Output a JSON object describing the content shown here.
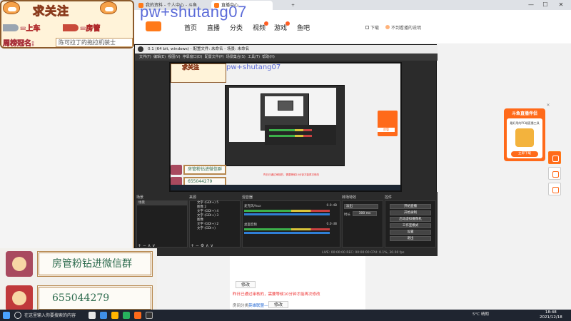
{
  "browser": {
    "tabs": [
      {
        "label": "..."
      },
      {
        "label": "我的资料 - 个人中心 - 斗鱼"
      },
      {
        "label": "直播中心"
      },
      {
        "label": "+"
      }
    ],
    "window_controls": [
      "—",
      "☐",
      "✕"
    ]
  },
  "site": {
    "nav": [
      "首页",
      "直播",
      "分类",
      "视频",
      "游戏",
      "鱼吧"
    ],
    "header_right": [
      "下载",
      "不到看播的说明"
    ]
  },
  "overlay": {
    "title": "求关注",
    "row1_text": "=上车",
    "row2_text": "=房管",
    "fan_label": "周榜冠名:",
    "fan_name": "陈可拉丁的拖拉机装士",
    "stream_id": "pw+shutang07",
    "box1_text": "房管粉钻进微信群",
    "box2_text": "655044279"
  },
  "obs": {
    "title": "0.1 (64 bit, windows) - 配置文件: 未命名 - 场景: 未命名",
    "menu": [
      "文件(F)",
      "编辑(E)",
      "视图(V)",
      "停靠窗口(D)",
      "配置文件(P)",
      "场景集合(S)",
      "工具(T)",
      "帮助(H)"
    ],
    "docks": {
      "scenes": "场景",
      "sources": "来源",
      "mixer": "混音器",
      "transitions": "转场特效",
      "controls": "控件"
    },
    "scene_items": [
      "场景"
    ],
    "source_items": [
      "文字 (GDI+) 5",
      "图像 2",
      "文字 (GDI+) 4",
      "文字 (GDI+) 3",
      "图像",
      "文字 (GDI+) 2",
      "文字 (GDI+)"
    ],
    "mixer_tracks": [
      {
        "name": "桌面音频",
        "db": "0.0 dB"
      },
      {
        "name": "麦克风/Aux",
        "db": "0.0 dB"
      }
    ],
    "transition": {
      "type": "淡出",
      "duration_label": "时长",
      "duration": "300 ms"
    },
    "controls": [
      "开始直播",
      "开始录制",
      "启动虚拟摄像机",
      "工作室模式",
      "设置",
      "退出"
    ],
    "preview_side_btn": "房管",
    "status": "LIVE: 00:00:00   REC: 00:00:00   CPU: 0.1%, 30.00 fps"
  },
  "page": {
    "button_label": "修改",
    "red_notice": "昨日已通过审核的，需要等候10分钟才能再次修改",
    "label1": "房间分类:",
    "link1": "英雄联盟——嗨玩",
    "button2_label": "修改"
  },
  "promo": {
    "title": "斗鱼直播伴侣",
    "desc": "最好用的PC端直播工具",
    "button": "立即下载",
    "close": "✕"
  },
  "taskbar": {
    "search": "在这里输入你要搜索的内容",
    "weather": "5°C 晴朗",
    "time": "18:48",
    "date": "2021/12/18"
  }
}
